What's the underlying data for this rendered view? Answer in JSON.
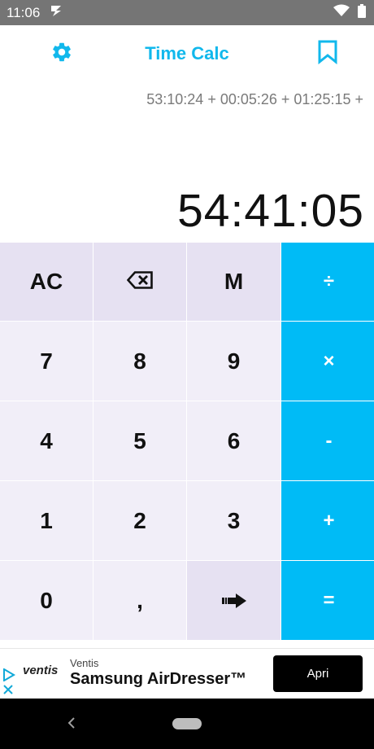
{
  "status_bar": {
    "time": "11:06",
    "icons": [
      "notification-icon",
      "wifi-icon",
      "battery-icon"
    ]
  },
  "header": {
    "title": "Time Calc",
    "left_icon": "gear-icon",
    "right_icon": "bookmark-icon",
    "accent_color": "#11b8ec"
  },
  "display": {
    "expression": "53:10:24 + 00:05:26 + 01:25:15 +",
    "result": "54:41:05"
  },
  "keypad": {
    "ac": "AC",
    "backspace_icon": "backspace-icon",
    "memory": "M",
    "divide": "÷",
    "seven": "7",
    "eight": "8",
    "nine": "9",
    "multiply": "×",
    "four": "4",
    "five": "5",
    "six": "6",
    "minus": "-",
    "one": "1",
    "two": "2",
    "three": "3",
    "plus": "+",
    "zero": "0",
    "comma": ",",
    "enter_icon": "arrow-right-icon",
    "equals": "=",
    "operator_color": "#00bbf6"
  },
  "ad": {
    "logo_text": "ventis",
    "brand": "Ventis",
    "product": "Samsung AirDresser™",
    "cta": "Apri"
  }
}
